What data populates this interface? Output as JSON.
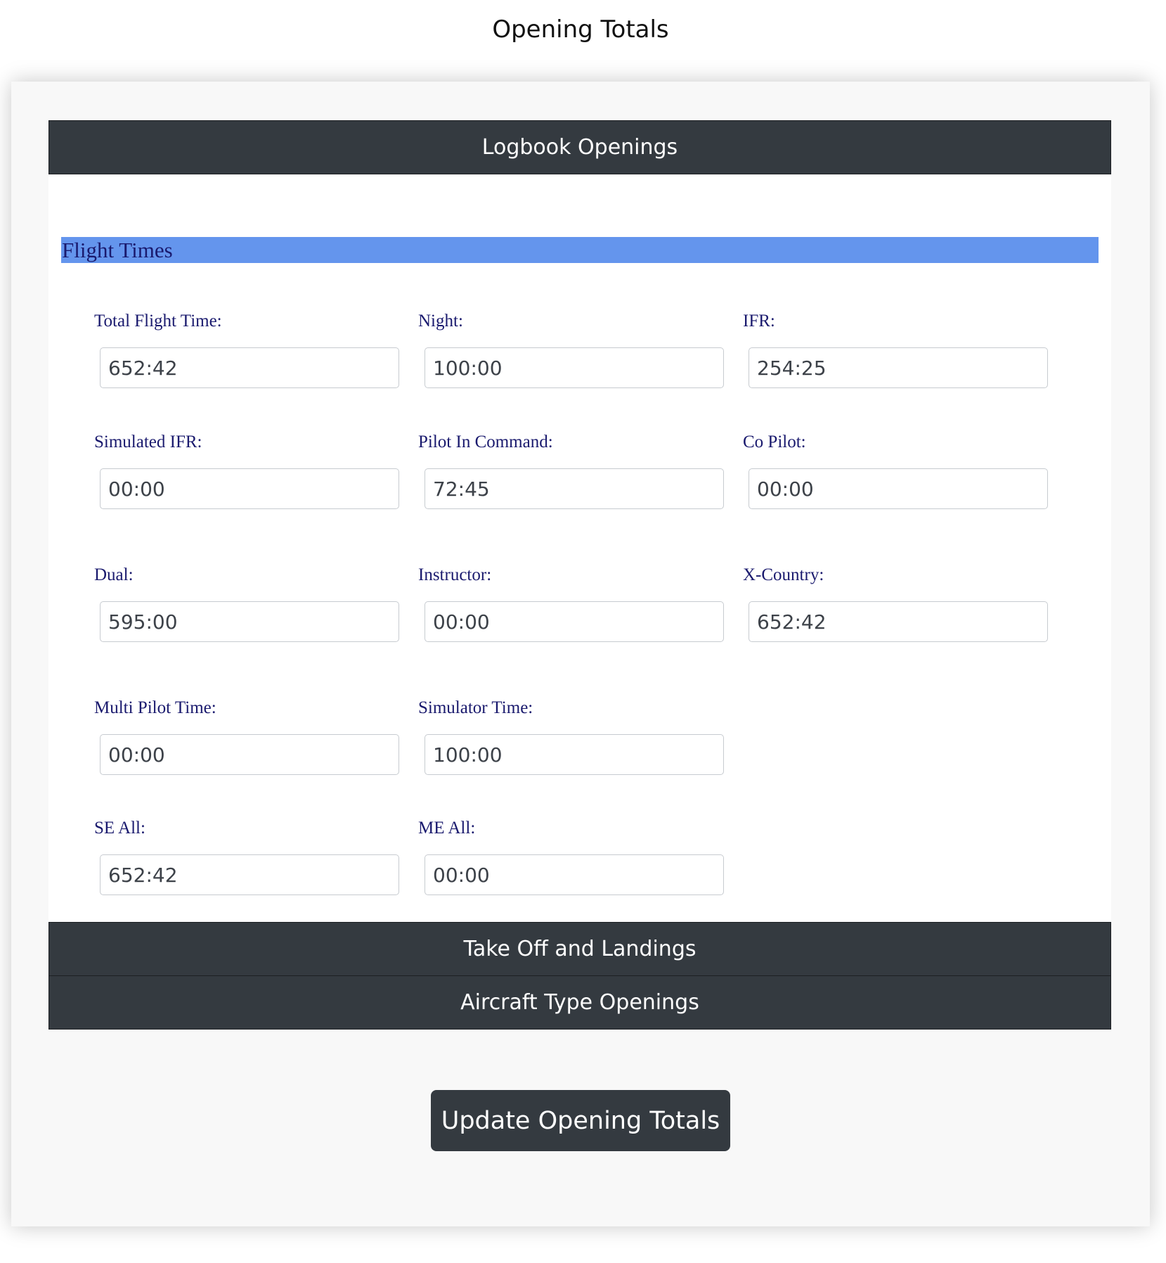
{
  "page": {
    "title": "Opening Totals"
  },
  "sections": {
    "logbook_openings": "Logbook Openings",
    "take_off_and_landings": "Take Off and Landings",
    "aircraft_type_openings": "Aircraft Type Openings"
  },
  "flight_times": {
    "header": "Flight Times",
    "fields": {
      "total_flight_time": {
        "label": "Total Flight Time:",
        "value": "652:42"
      },
      "night": {
        "label": "Night:",
        "value": "100:00"
      },
      "ifr": {
        "label": "IFR:",
        "value": "254:25"
      },
      "simulated_ifr": {
        "label": "Simulated IFR:",
        "value": "00:00"
      },
      "pilot_in_command": {
        "label": "Pilot In Command:",
        "value": "72:45"
      },
      "co_pilot": {
        "label": "Co Pilot:",
        "value": "00:00"
      },
      "dual": {
        "label": "Dual:",
        "value": "595:00"
      },
      "instructor": {
        "label": "Instructor:",
        "value": "00:00"
      },
      "x_country": {
        "label": "X-Country:",
        "value": "652:42"
      },
      "multi_pilot_time": {
        "label": "Multi Pilot Time:",
        "value": "00:00"
      },
      "simulator_time": {
        "label": "Simulator Time:",
        "value": "100:00"
      },
      "se_all": {
        "label": "SE All:",
        "value": "652:42"
      },
      "me_all": {
        "label": "ME All:",
        "value": "00:00"
      }
    }
  },
  "actions": {
    "update_button": "Update Opening Totals"
  }
}
